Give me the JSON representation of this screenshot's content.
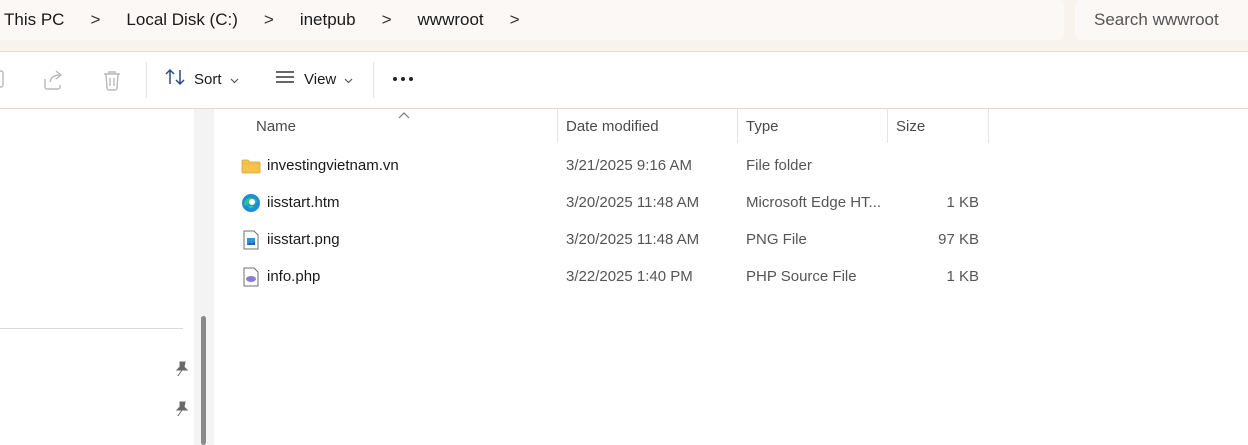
{
  "breadcrumb": {
    "items": [
      "This PC",
      "Local Disk (C:)",
      "inetpub",
      "wwwroot"
    ],
    "separator": ">"
  },
  "search": {
    "placeholder": "Search wwwroot"
  },
  "toolbar": {
    "sort_label": "Sort",
    "view_label": "View",
    "icons": [
      "copy-icon",
      "share-icon",
      "delete-icon",
      "sort-icon",
      "view-icon",
      "more-options-icon"
    ]
  },
  "columns": {
    "name": "Name",
    "date": "Date modified",
    "type": "Type",
    "size": "Size"
  },
  "files": [
    {
      "name": "investingvietnam.vn",
      "date": "3/21/2025 9:16 AM",
      "type": "File folder",
      "size": "",
      "icon": "folder-icon"
    },
    {
      "name": "iisstart.htm",
      "date": "3/20/2025 11:48 AM",
      "type": "Microsoft Edge HT...",
      "size": "1 KB",
      "icon": "edge-icon"
    },
    {
      "name": "iisstart.png",
      "date": "3/20/2025 11:48 AM",
      "type": "PNG File",
      "size": "97 KB",
      "icon": "image-file-icon"
    },
    {
      "name": "info.php",
      "date": "3/22/2025 1:40 PM",
      "type": "PHP Source File",
      "size": "1 KB",
      "icon": "php-file-icon"
    }
  ],
  "colors": {
    "address_bg": "#fbf8f5",
    "toolbar_bg": "#f9f3ee",
    "folder": "#f5c24a",
    "edge": "#1f8dd6"
  }
}
